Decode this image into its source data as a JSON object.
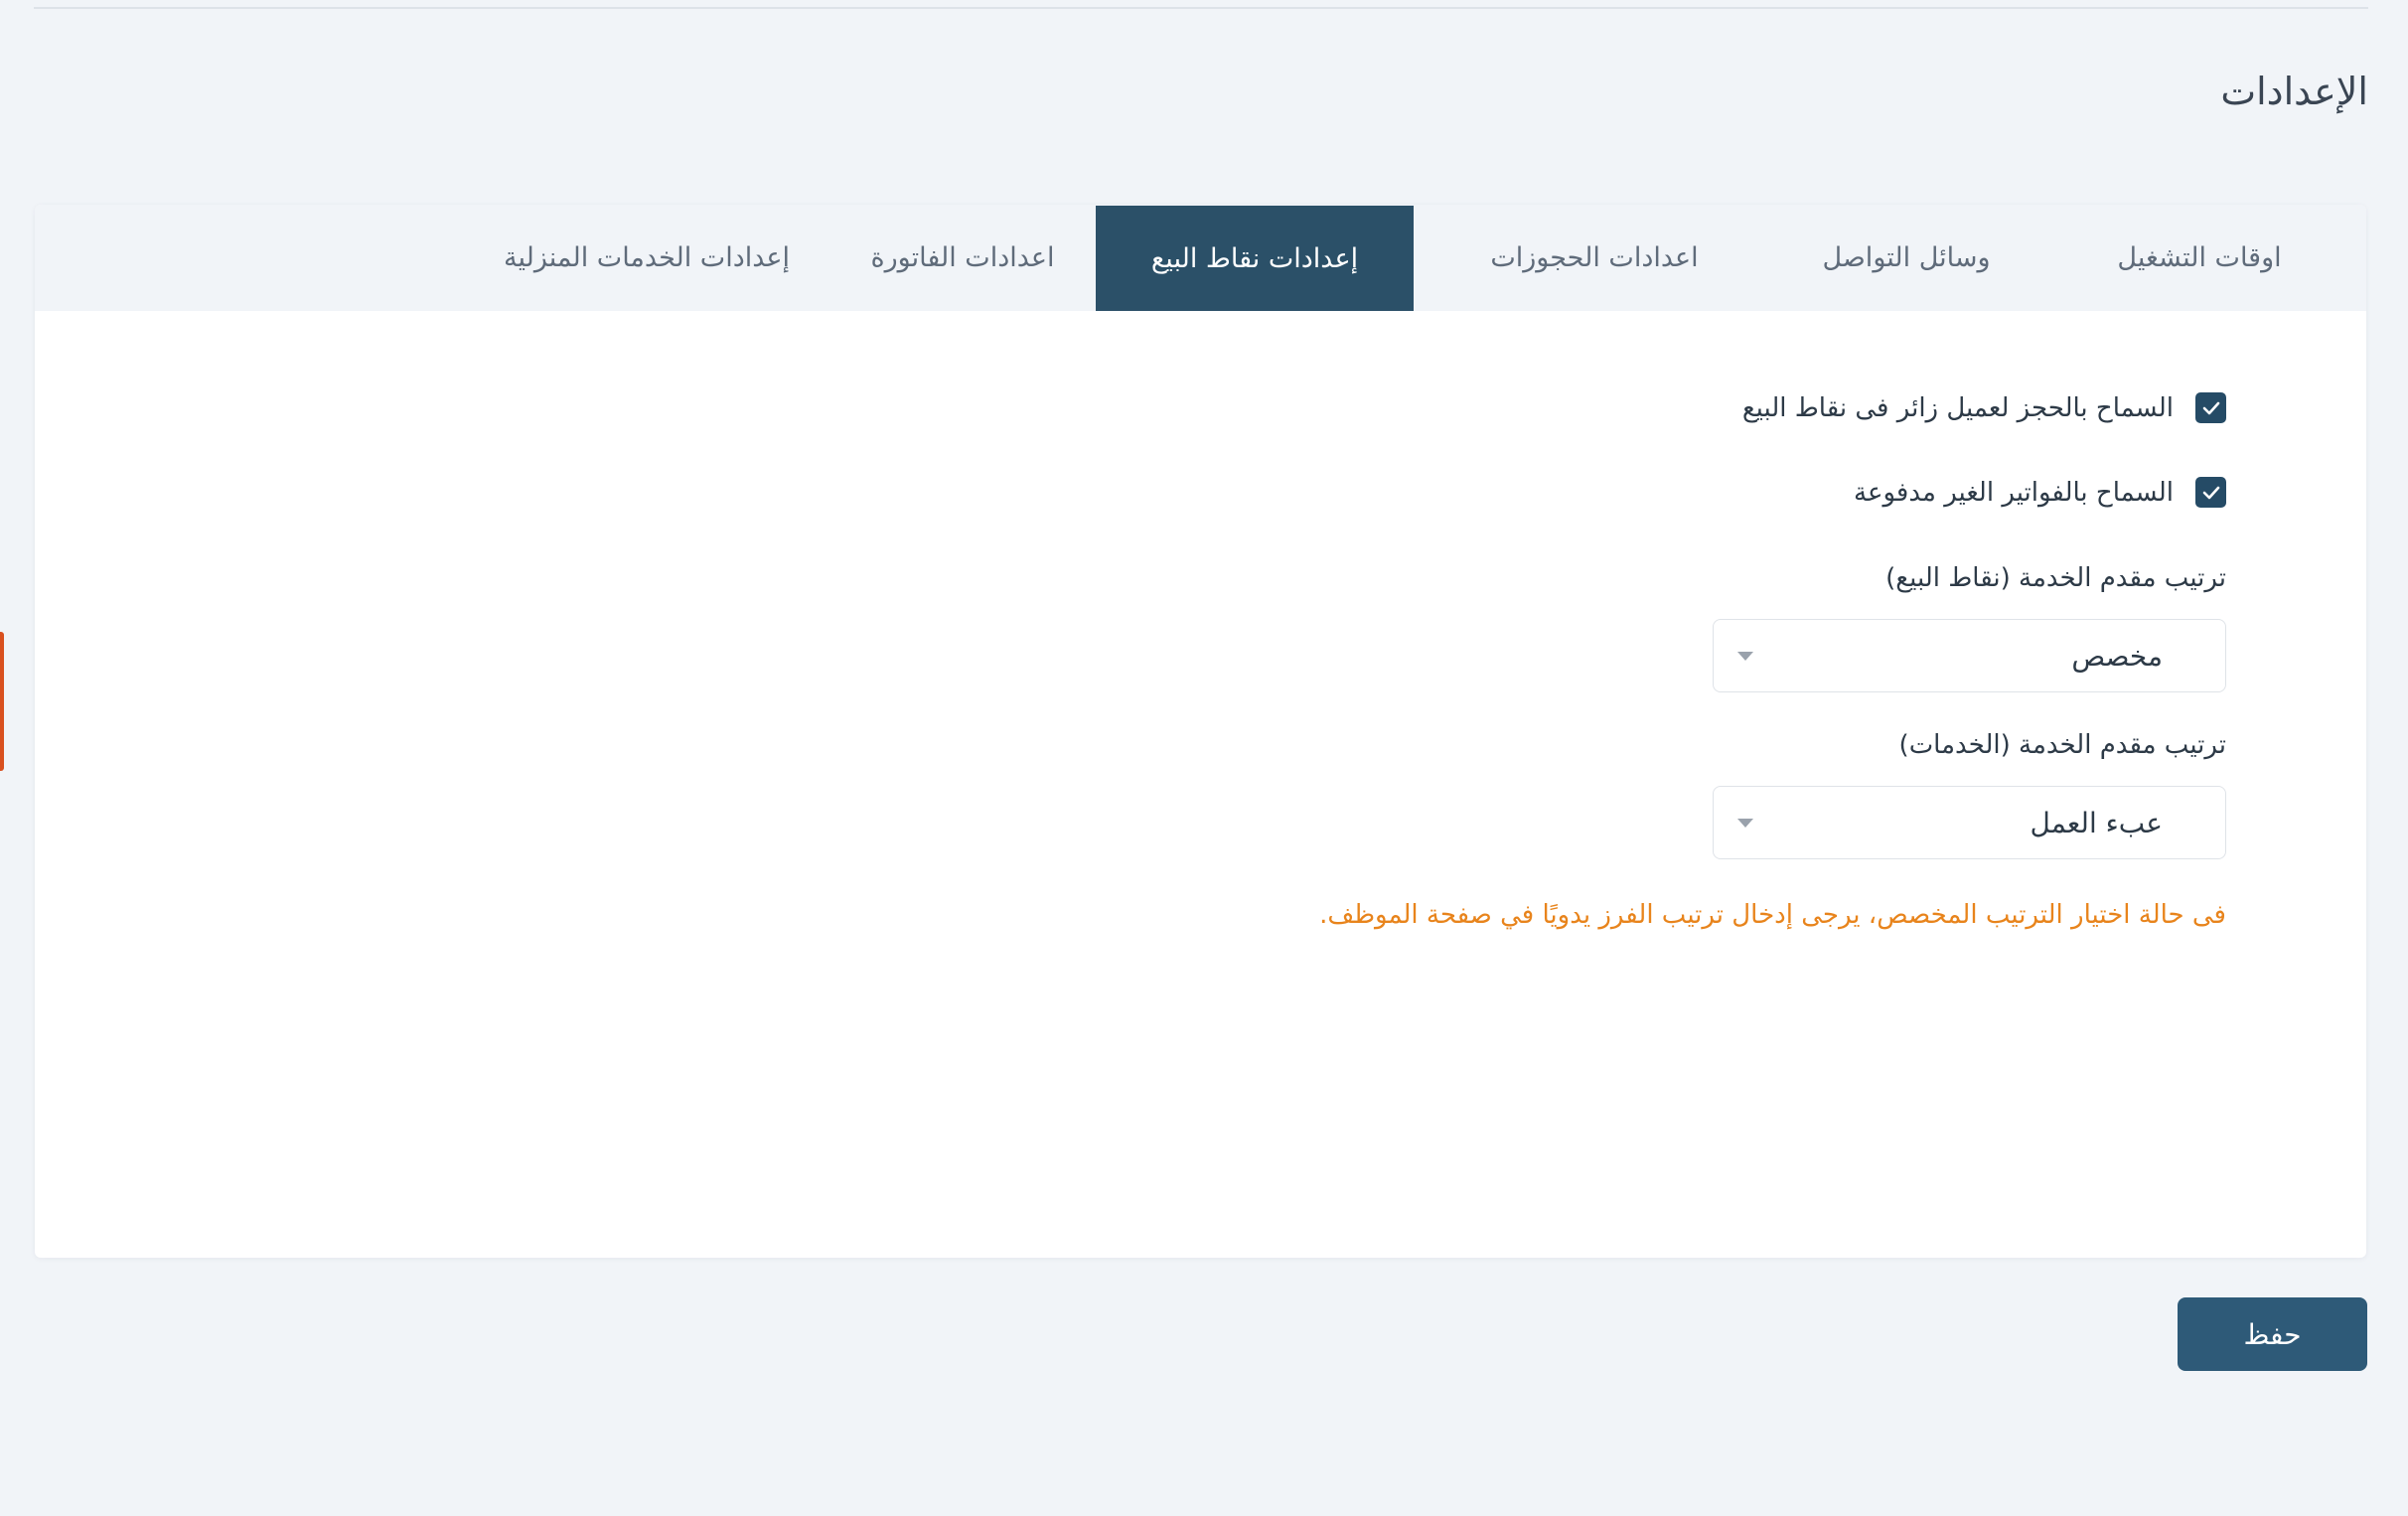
{
  "page": {
    "title": "الإعدادات"
  },
  "tabs": [
    {
      "label": "اوقات التشغيل",
      "active": false
    },
    {
      "label": "وسائل التواصل",
      "active": false
    },
    {
      "label": "اعدادات الحجوزات",
      "active": false
    },
    {
      "label": "إعدادات نقاط البيع",
      "active": true
    },
    {
      "label": "اعدادات الفاتورة",
      "active": false
    },
    {
      "label": "إعدادات الخدمات المنزلية",
      "active": false
    }
  ],
  "pos_settings": {
    "checkboxes": [
      {
        "label": "السماح بالحجز لعميل زائر فى نقاط البيع",
        "checked": true
      },
      {
        "label": "السماح بالفواتير الغير مدفوعة",
        "checked": true
      }
    ],
    "pos_provider_order": {
      "label": "ترتيب مقدم الخدمة (نقاط البيع)",
      "value": "مخصص"
    },
    "services_provider_order": {
      "label": "ترتيب مقدم الخدمة (الخدمات)",
      "value": "عبء العمل"
    },
    "note": "فى حالة اختيار الترتيب المخصص، يرجى إدخال ترتيب الفرز يدويًا في صفحة الموظف."
  },
  "actions": {
    "save_label": "حفظ"
  },
  "colors": {
    "accent": "#2b5068",
    "button": "#2e5a78",
    "warning_text": "#e8841c",
    "background": "#f1f4f8",
    "side_handle": "#d9501f"
  }
}
